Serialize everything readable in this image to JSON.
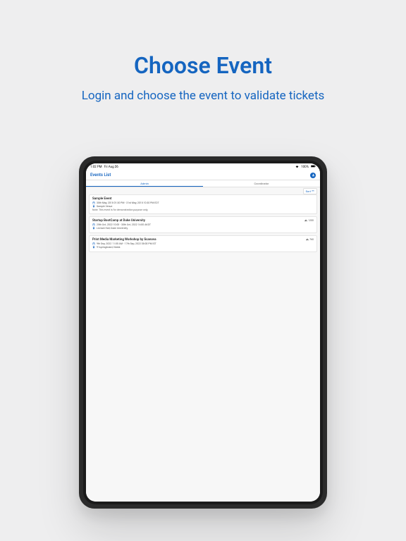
{
  "hero": {
    "title": "Choose Event",
    "subtitle": "Login and choose the event to validate tickets"
  },
  "status": {
    "time": "1:02 PM",
    "date": "Fri Aug 26",
    "battery": "100%"
  },
  "header": {
    "title": "Events List"
  },
  "tabs": {
    "admin": "Admin",
    "coordinator": "Coordinator"
  },
  "sort": {
    "label": "Sort"
  },
  "events": [
    {
      "title": "Sample Event",
      "datetime": "30th May, 2018 01:30 PM - 31st May, 2018 10:30 PM EDT",
      "venue": "Sample Venue",
      "note": "Note: This event is for demonstration purpose only.",
      "count": ""
    },
    {
      "title": "Startup BootCamp at Duke University",
      "datetime": "25th Oct, 2022 10:00 - 30th Oct, 2022 14:00 AKDT",
      "venue": "Lecture Hall, Duke University",
      "note": "",
      "count": "1200"
    },
    {
      "title": "Print Media Marketing Workshop by Scanova",
      "datetime": "9th Sep, 2022 11:00 AM - 17th Sep, 2022 08:00 PM IST",
      "venue": "91springboard, Noida",
      "note": "",
      "count": "760"
    }
  ]
}
